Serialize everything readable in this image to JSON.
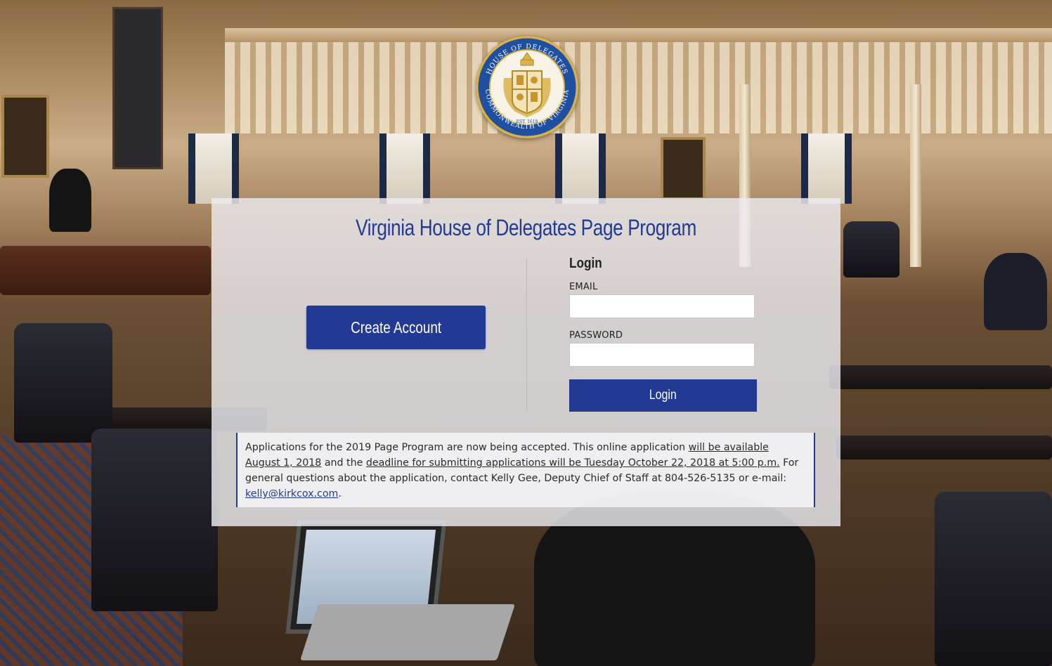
{
  "seal": {
    "top_text": "HOUSE OF DELEGATES",
    "bottom_text": "COMMONWEALTH OF VIRGINIA",
    "est_text": "EST. 1619"
  },
  "page": {
    "title": "Virginia House of Delegates Page Program"
  },
  "create_account": {
    "label": "Create Account"
  },
  "login": {
    "heading": "Login",
    "email_label": "EMAIL",
    "email_value": "",
    "password_label": "PASSWORD",
    "password_value": "",
    "button_label": "Login"
  },
  "notice": {
    "part1": "Applications for the 2019 Page Program are now being accepted. This online application ",
    "link1": "will be available August 1, 2018",
    "part2": " and the ",
    "link2": "deadline for submitting applications will be Tuesday October 22, 2018 at 5:00 p.m.",
    "part3": " For general questions about the application, contact Kelly Gee, Deputy Chief of Staff at 804-526-5135 or e-mail: ",
    "email_link": "kelly@kirkcox.com",
    "part4": "."
  },
  "colors": {
    "brand_blue": "#233a95",
    "seal_gold": "#d9b24a",
    "seal_blue": "#1f4fa0"
  }
}
